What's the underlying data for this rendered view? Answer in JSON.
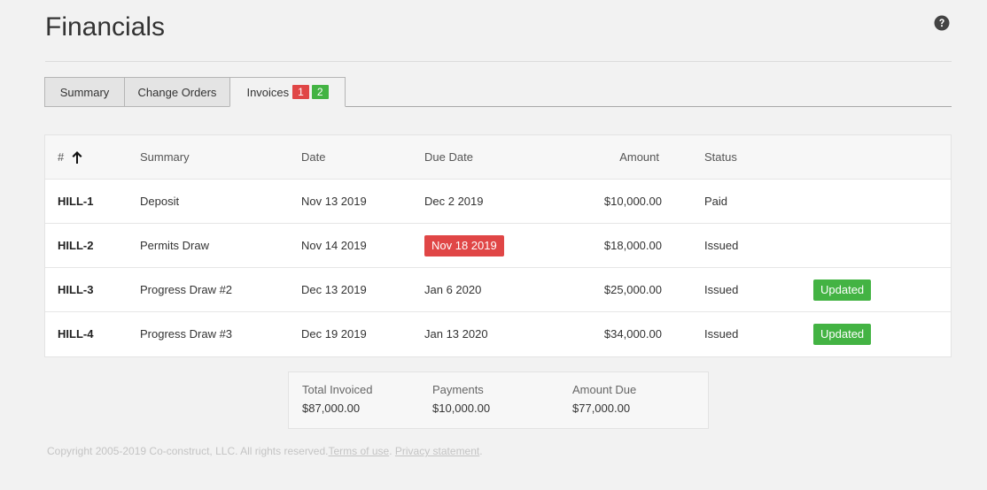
{
  "header": {
    "title": "Financials"
  },
  "tabs": [
    {
      "label": "Summary"
    },
    {
      "label": "Change Orders"
    },
    {
      "label": "Invoices",
      "badge_red": "1",
      "badge_green": "2"
    }
  ],
  "table": {
    "columns": {
      "num": "#",
      "summary": "Summary",
      "date": "Date",
      "due_date": "Due Date",
      "amount": "Amount",
      "status": "Status"
    },
    "rows": [
      {
        "id": "HILL-1",
        "summary": "Deposit",
        "date": "Nov 13 2019",
        "due_date": "Dec 2 2019",
        "amount": "$10,000.00",
        "status": "Paid",
        "flag": ""
      },
      {
        "id": "HILL-2",
        "summary": "Permits Draw",
        "date": "Nov 14 2019",
        "due_date": "Nov 18 2019",
        "amount": "$18,000.00",
        "status": "Issued",
        "flag": ""
      },
      {
        "id": "HILL-3",
        "summary": "Progress Draw #2",
        "date": "Dec 13 2019",
        "due_date": "Jan 6 2020",
        "amount": "$25,000.00",
        "status": "Issued",
        "flag": "Updated"
      },
      {
        "id": "HILL-4",
        "summary": "Progress Draw #3",
        "date": "Dec 19 2019",
        "due_date": "Jan 13 2020",
        "amount": "$34,000.00",
        "status": "Issued",
        "flag": "Updated"
      }
    ]
  },
  "totals": {
    "invoiced_label": "Total Invoiced",
    "invoiced_value": "$87,000.00",
    "payments_label": "Payments",
    "payments_value": "$10,000.00",
    "due_label": "Amount Due",
    "due_value": "$77,000.00"
  },
  "footer": {
    "copyright": "Copyright 2005-2019 Co-construct, LLC. All rights reserved.",
    "terms": "Terms of use",
    "separator": ". ",
    "privacy": "Privacy statement",
    "end": "."
  },
  "colors": {
    "overdue": "#e04646",
    "updated": "#43b343",
    "badge_red": "#e04646",
    "badge_green": "#43b343"
  },
  "icons": {
    "help": "question-circle-icon",
    "sort": "arrow-up-icon"
  }
}
